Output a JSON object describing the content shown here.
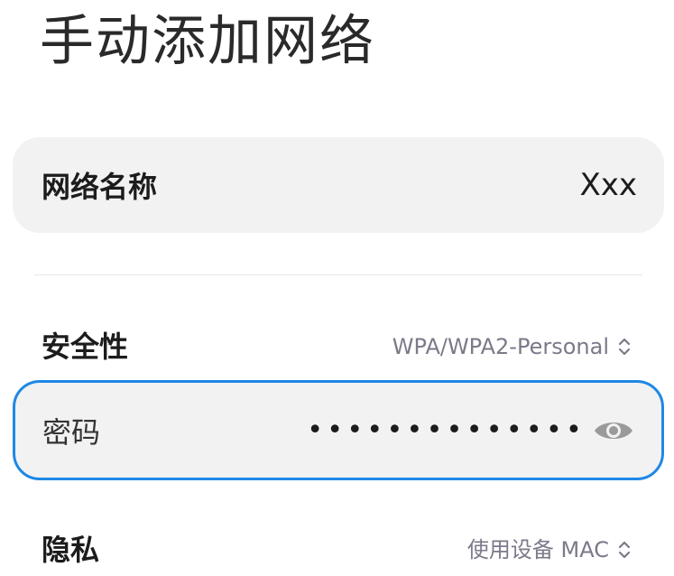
{
  "page": {
    "title": "手动添加网络"
  },
  "ssid": {
    "label": "网络名称",
    "value": "Xxx"
  },
  "security": {
    "label": "安全性",
    "value": "WPA/WPA2-Personal",
    "icon": "updown-chevron-icon"
  },
  "password": {
    "label": "密码",
    "value": "••••••••••••••",
    "icon": "eye-icon"
  },
  "privacy": {
    "label": "隐私",
    "value": "使用设备 MAC",
    "icon": "updown-chevron-icon"
  },
  "colors": {
    "accent": "#1e88e5",
    "card_bg": "#f2f2f2",
    "secondary_text": "#7a7a8a"
  }
}
